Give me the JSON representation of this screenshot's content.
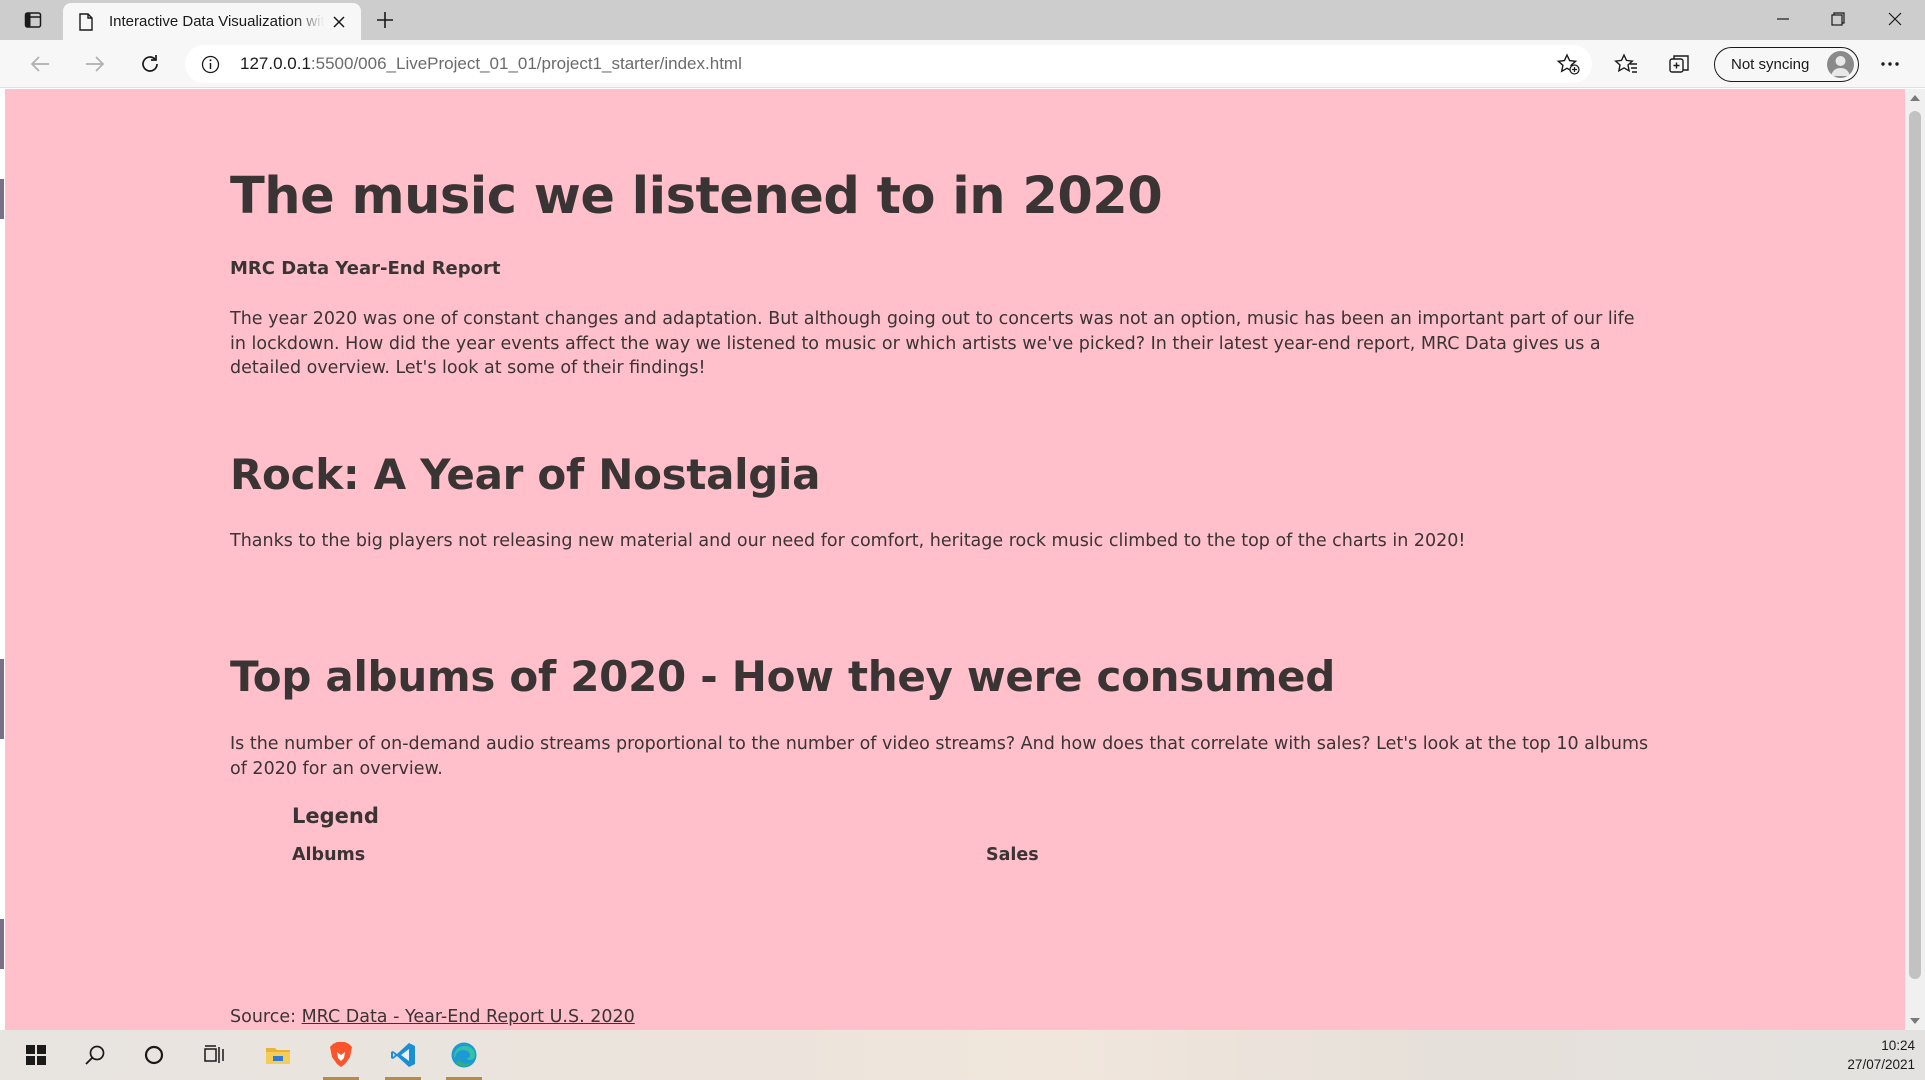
{
  "browser": {
    "tab_title": "Interactive Data Visualization with",
    "url_host": "127.0.0.1",
    "url_rest": ":5500/006_LiveProject_01_01/project1_starter/index.html",
    "sync_label": "Not syncing"
  },
  "page": {
    "title": "The music we listened to in 2020",
    "subtitle": "MRC Data Year-End Report",
    "intro": "The year 2020 was one of constant changes and adaptation. But although going out to concerts was not an option, music has been an important part of our life in lockdown. How did the year events affect the way we listened to music or which artists we've picked? In their latest year-end report, MRC Data gives us a detailed overview. Let's look at some of their findings!",
    "rock_heading": "Rock: A Year of Nostalgia",
    "rock_text": "Thanks to the big players not releasing new material and our need for comfort, heritage rock music climbed to the top of the charts in 2020!",
    "albums_heading": "Top albums of 2020 - How they were consumed",
    "albums_text": "Is the number of on-demand audio streams proportional to the number of video streams? And how does that correlate with sales? Let's look at the top 10 albums of 2020 for an overview.",
    "legend_title": "Legend",
    "legend_albums": "Albums",
    "legend_sales": "Sales",
    "source_label": "Source: ",
    "source_link": "MRC Data - Year-End Report U.S. 2020"
  },
  "taskbar": {
    "time": "10:24",
    "date": "27/07/2021"
  },
  "colors": {
    "page_background": "#ffc0cb",
    "text": "#3a3434"
  }
}
